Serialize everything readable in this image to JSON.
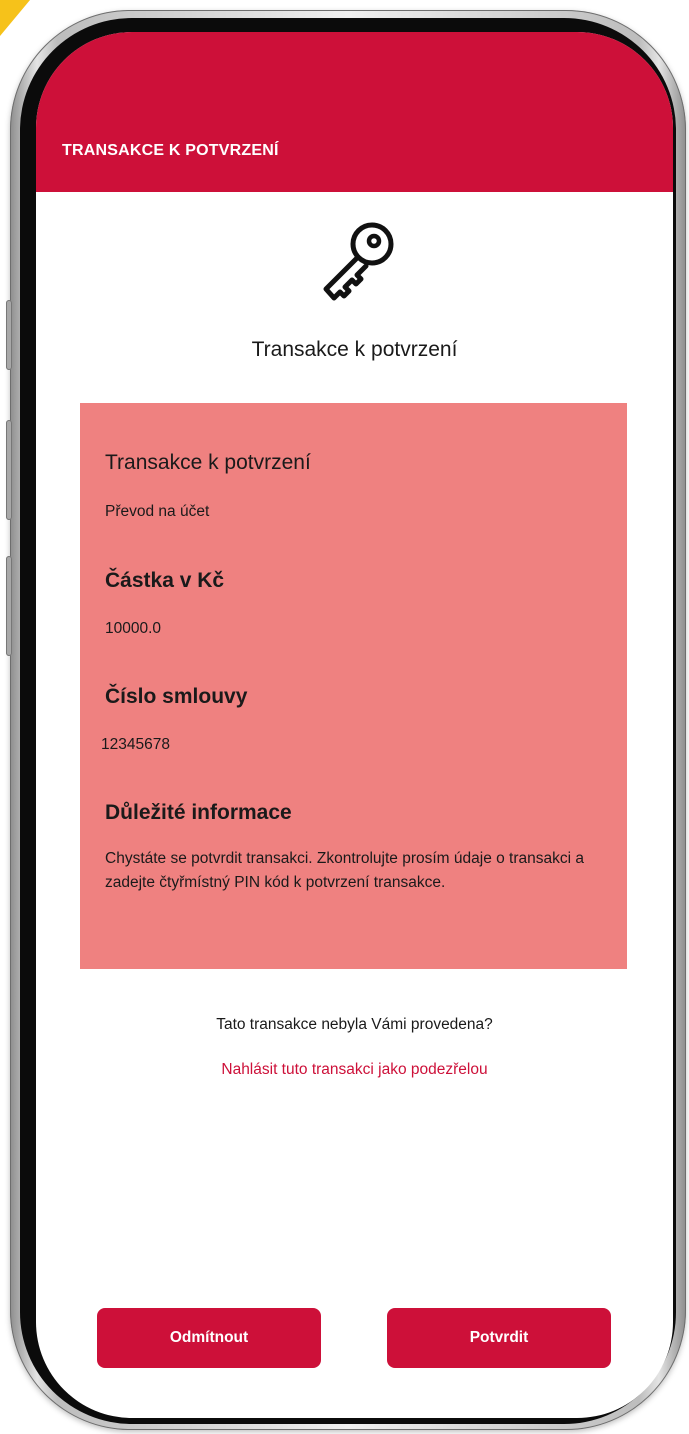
{
  "header": {
    "title": "TRANSAKCE K POTVRZENÍ"
  },
  "main": {
    "icon": "key-icon",
    "title": "Transakce k potvrzení"
  },
  "card": {
    "transaction_heading": "Transakce k potvrzení",
    "transaction_value": "Převod na účet",
    "amount_heading": "Částka v Kč",
    "amount_value": "10000.0",
    "contract_heading": "Číslo smlouvy",
    "contract_value": "12345678",
    "info_heading": "Důležité informace",
    "info_text": "Chystáte se potvrdit transakci. Zkontrolujte prosím údaje o transakci a zadejte čtyřmístný PIN kód k potvrzení transakce."
  },
  "footer": {
    "question": "Tato transakce nebyla Vámi provedena?",
    "report_link": "Nahlásit tuto transakci jako podezřelou"
  },
  "actions": {
    "reject_label": "Odmítnout",
    "confirm_label": "Potvrdit"
  },
  "colors": {
    "brand": "#cd1039",
    "card_background": "#ef8180",
    "text": "#1a1a1a"
  }
}
